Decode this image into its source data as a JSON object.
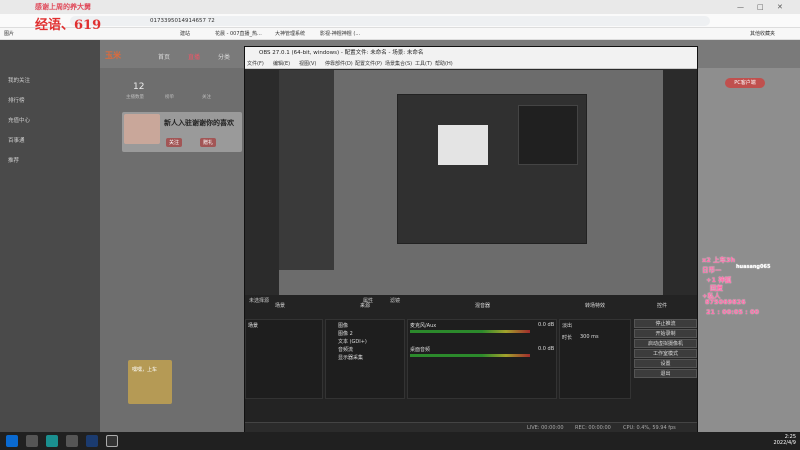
{
  "browser": {
    "url": "0173395014914657 72",
    "bookmarks": [
      "建站",
      "花晨 - 007直播_热...",
      "大神管理系统",
      "影视-神棍神棍 (...",
      "其他收藏夹"
    ],
    "bookmark_prefix": "图片",
    "win_controls": [
      "—",
      "□",
      "✕"
    ]
  },
  "stream_banner": {
    "line1": "感谢上周的养大舅",
    "line2": "经语、619"
  },
  "site": {
    "logo": "玉米",
    "nav": [
      "首页",
      "直播",
      "分类"
    ],
    "stats": [
      {
        "value": "12",
        "label": "主播数量"
      },
      {
        "value": "",
        "label": "榜单"
      },
      {
        "value": "",
        "label": "关注"
      }
    ],
    "newsbox_title": "新人入驻谢谢你的喜欢",
    "sidebar_items": [
      "我的关注",
      "排行榜",
      "充值中心",
      "百事通",
      "推荐"
    ],
    "right_badge": "PC客户端",
    "gift_box_label": "嘿嘿，上车",
    "buttons": [
      "关注",
      "赠礼"
    ]
  },
  "overlay": {
    "lines": [
      "x2 上车3h",
      "日币—",
      "+1 神狐",
      "回复",
      "+私人",
      "875069826",
      "21 : 00:05 : 00"
    ],
    "side_name": "huasang065"
  },
  "obs": {
    "title": "OBS 27.0.1 (64-bit, windows) - 配置文件: 未命名 - 场景: 未命名",
    "menu": [
      "文件(F)",
      "编辑(E)",
      "视图(V)",
      "停靠部件(D)",
      "配置文件(P)",
      "场景集合(S)",
      "工具(T)",
      "帮助(H)"
    ],
    "not_selected": "未选择源",
    "props_label": "属性",
    "filters_label": "滤镜",
    "panel_headers": [
      "场景",
      "来源",
      "混音器",
      "转场特效",
      "控件"
    ],
    "scenes": [
      "场景"
    ],
    "sources": [
      "图像",
      "图像 2",
      "文本 (GDI+)",
      "音频流",
      "显示器采集"
    ],
    "mixer": [
      {
        "name": "麦克风/Aux",
        "db": "0.0 dB"
      },
      {
        "name": "桌面音频",
        "db": "0.0 dB"
      }
    ],
    "transition": {
      "type": "淡出",
      "duration_label": "时长",
      "duration": "300 ms"
    },
    "controls": [
      "停止推流",
      "开始录制",
      "启动虚拟摄像机",
      "工作室模式",
      "设置",
      "退出"
    ],
    "status": {
      "live": "LIVE: 00:00:00",
      "rec": "REC: 00:00:00",
      "cpu": "CPU: 0.4%, 59.94 fps"
    }
  },
  "taskbar": {
    "time": "2:25",
    "date": "2022/4/9"
  }
}
